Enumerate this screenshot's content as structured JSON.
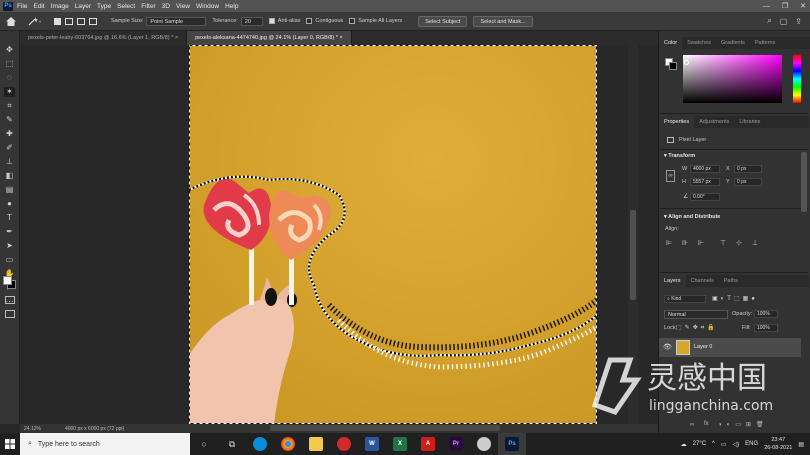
{
  "app": {
    "logo": "Ps",
    "minimize": "—",
    "restore": "❐",
    "close": "✕"
  },
  "menu": [
    "File",
    "Edit",
    "Image",
    "Layer",
    "Type",
    "Select",
    "Filter",
    "3D",
    "View",
    "Window",
    "Help"
  ],
  "options": {
    "sample_size_label": "Sample Size:",
    "sample_size_value": "Point Sample",
    "tolerance_label": "Tolerance:",
    "tolerance_value": "20",
    "anti_alias": "Anti-alias",
    "contiguous": "Contiguous",
    "sample_all_layers": "Sample All Layers",
    "select_subject": "Select Subject",
    "select_and_mask": "Select and Mask..."
  },
  "tabs": [
    {
      "label": "pexels-peter-leahy-603764.jpg @ 16.6% (Layer 1, RGB/8) *",
      "close": "×"
    },
    {
      "label": "pexels-aleksana-4474740.jpg @ 24.1% (Layer 0, RGB/8) *",
      "close": "×"
    }
  ],
  "status": {
    "zoom": "24.12%",
    "doc_info": "4000 px x 6000 px (72 ppi)"
  },
  "color_panel": {
    "tabs": [
      "Color",
      "Swatches",
      "Gradients",
      "Patterns"
    ]
  },
  "properties_panel": {
    "tabs": [
      "Properties",
      "Adjustments",
      "Libraries"
    ],
    "layer_type": "Pixel Layer",
    "transform_label": "Transform",
    "w_label": "W",
    "w_value": "4000 px",
    "h_label": "H",
    "h_value": "5557 px",
    "x_label": "X",
    "x_value": "0 px",
    "y_label": "Y",
    "y_value": "0 px",
    "angle_value": "0.00°",
    "align_label": "Align and Distribute",
    "align_sub": "Align:"
  },
  "layers_panel": {
    "tabs": [
      "Layers",
      "Channels",
      "Paths"
    ],
    "kind": "Kind",
    "blend_mode": "Normal",
    "opacity_label": "Opacity:",
    "opacity_value": "100%",
    "lock_label": "Lock:",
    "fill_label": "Fill:",
    "fill_value": "100%",
    "layer_name": "Layer 0",
    "footer_fx": "fx"
  },
  "taskbar": {
    "search_placeholder": "Type here to search",
    "temperature": "27°C",
    "language": "ENG",
    "time": "23:47",
    "date": "26-08-2021"
  },
  "watermark": {
    "cn": "灵感中国",
    "en": "lingganchina.com"
  },
  "colors": {
    "canvas_bg": "#d8a52f",
    "ps_blue": "#31a8ff",
    "panel_bg": "#323232"
  }
}
